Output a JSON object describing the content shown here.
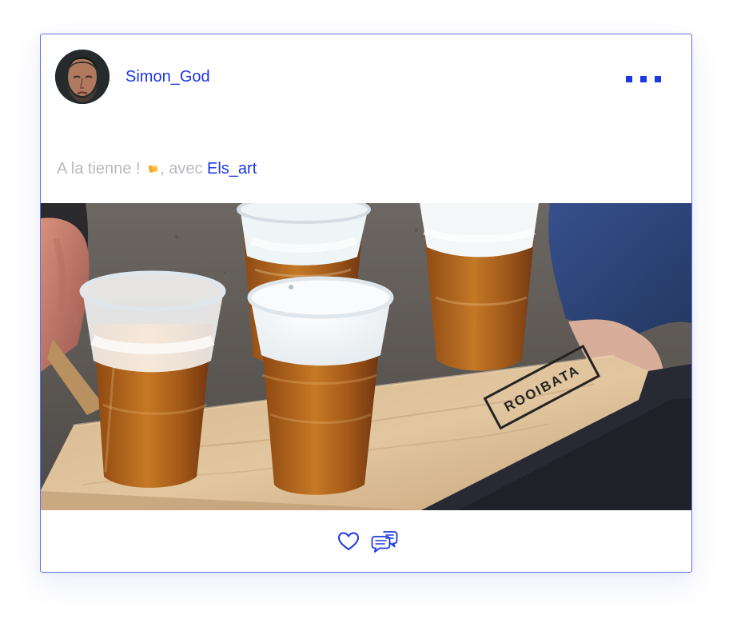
{
  "post": {
    "author": {
      "username": "Simon_God"
    },
    "caption": {
      "before_tag": "A la tienne ! ",
      "emoji_icon": "beer-mugs-icon",
      "connector": ", avec ",
      "tagged_user": "Els_art"
    },
    "image_alt": "Plastic cups of beer on a wooden tray",
    "image_text": "ROOIBATA",
    "more_icon": "more-options-icon",
    "like_icon": "heart-outline-icon",
    "comment_icon": "chat-bubbles-icon",
    "colors": {
      "accent": "#1d37e3",
      "caption_text": "#b9b9c4",
      "card_border": "#5b72e8"
    }
  }
}
